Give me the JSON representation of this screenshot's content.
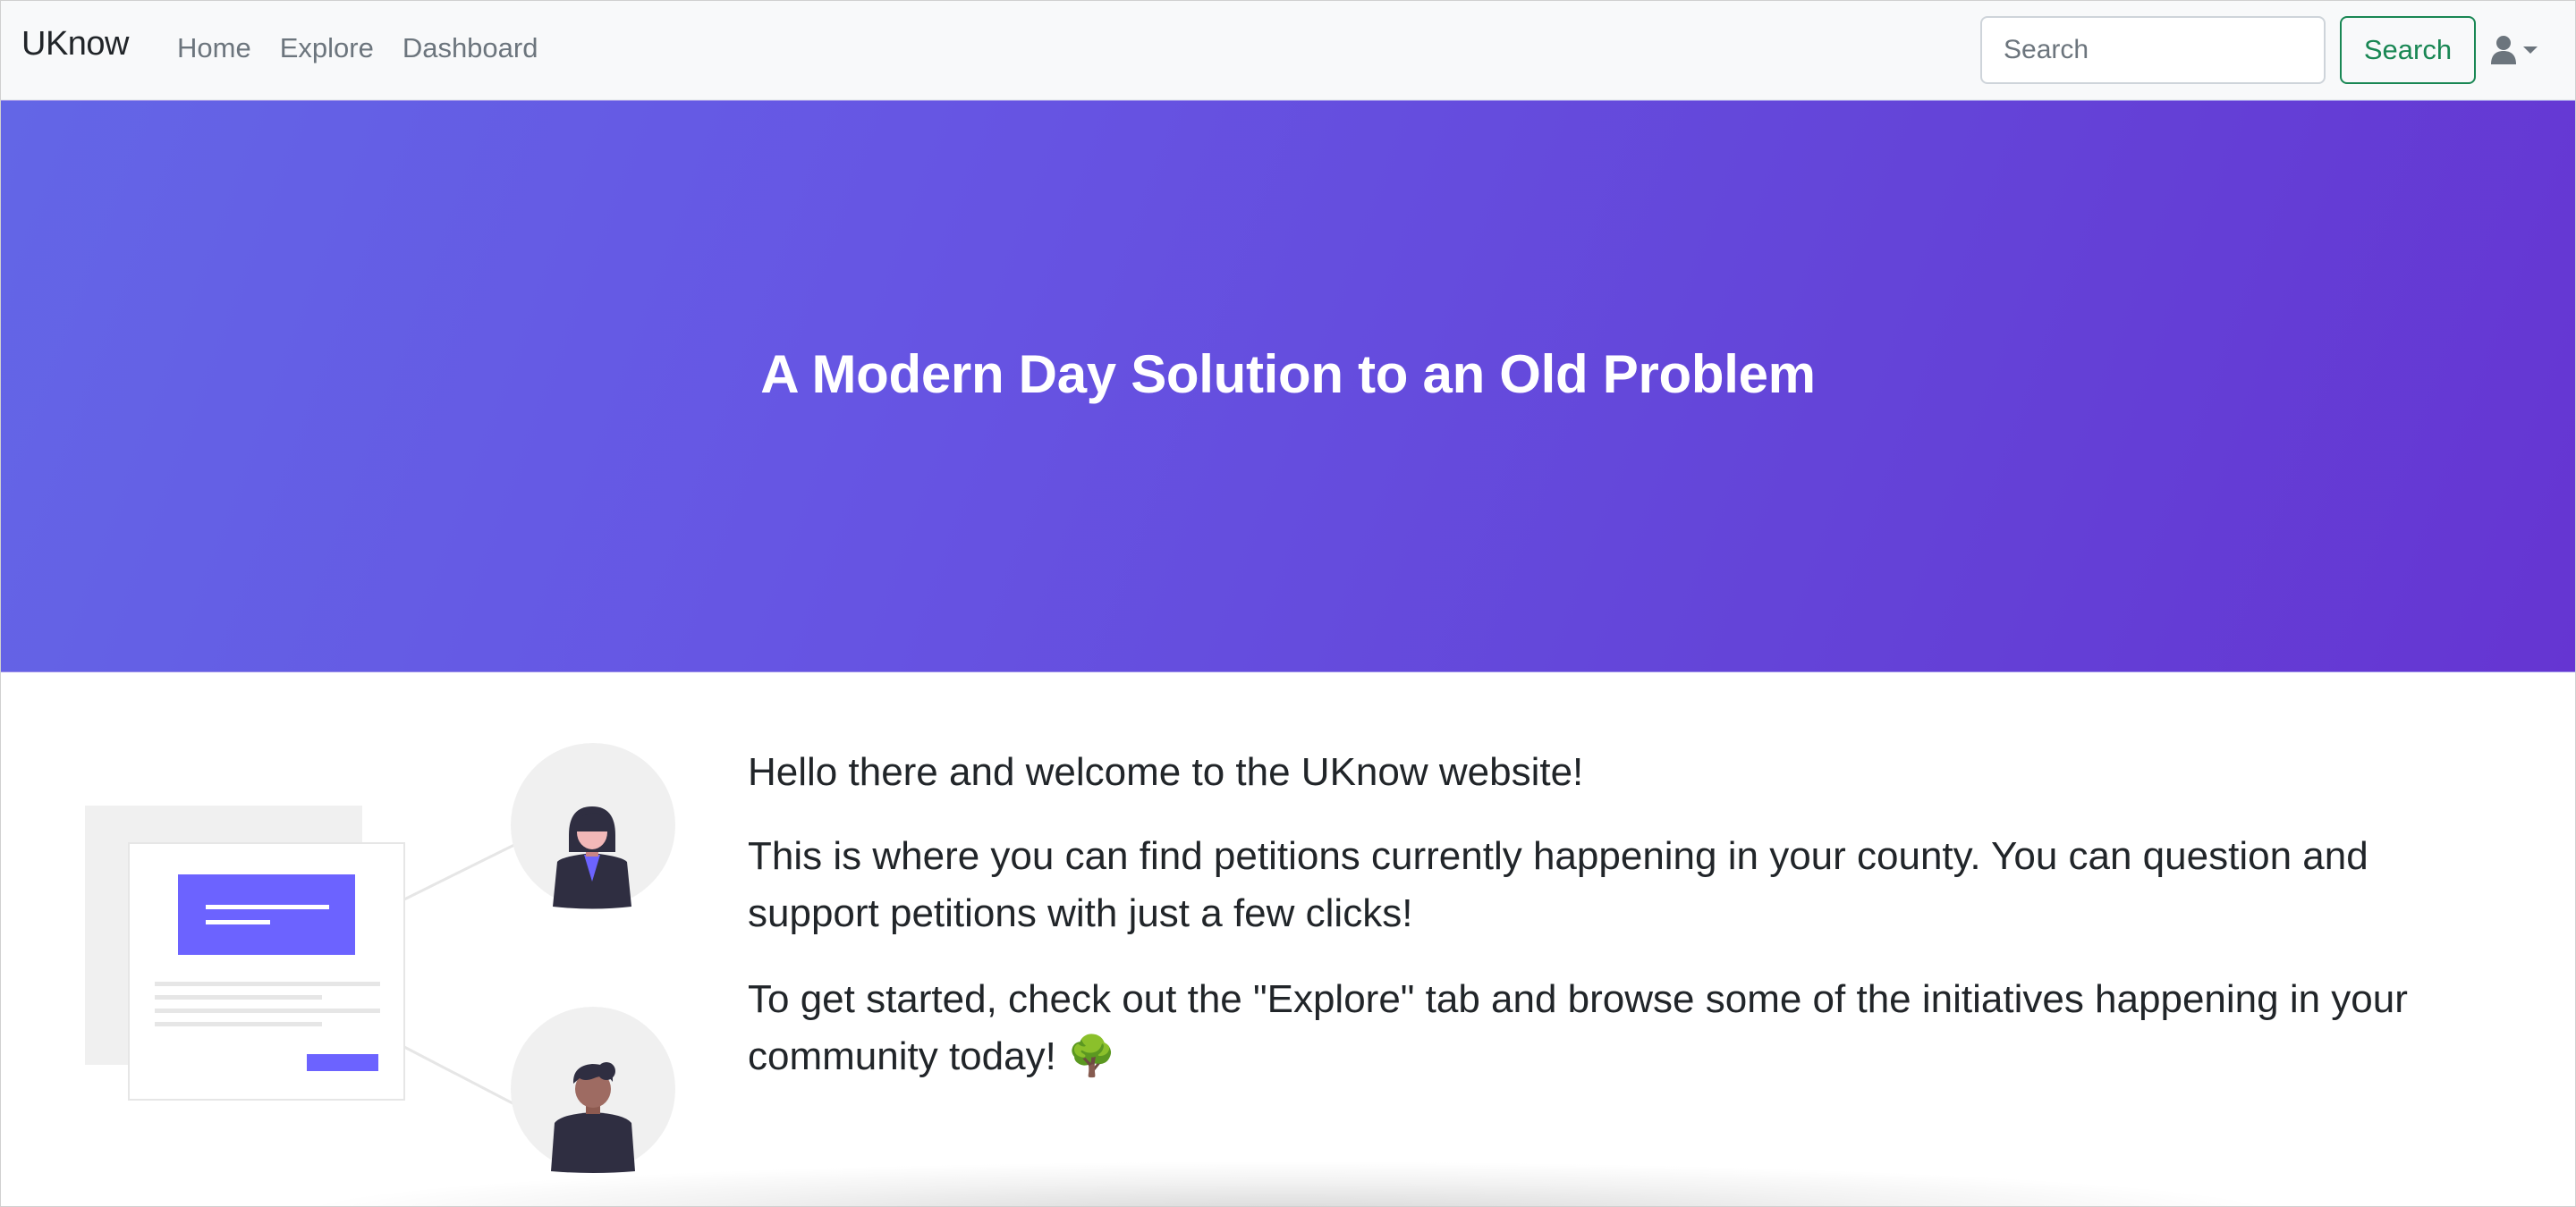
{
  "navbar": {
    "brand": "UKnow",
    "links": [
      {
        "label": "Home"
      },
      {
        "label": "Explore"
      },
      {
        "label": "Dashboard"
      }
    ],
    "search": {
      "placeholder": "Search",
      "value": "",
      "button_label": "Search"
    },
    "user_menu_icon": "user-icon",
    "user_menu_caret": "caret-down-icon"
  },
  "hero": {
    "title": "A Modern Day Solution to an Old Problem",
    "gradient_colors": [
      "#6366e6",
      "#6535d2"
    ]
  },
  "welcome": {
    "paragraphs": [
      "Hello there and welcome to the UKnow website!",
      "This is where you can find petitions currently happening in your county. You can question and support petitions with just a few clicks!",
      "To get started, check out the \"Explore\" tab and browse some of the initiatives happening in your community today! 🌳"
    ]
  },
  "colors": {
    "accent": "#6c63ff",
    "success": "#198754",
    "navbar_bg": "#f8f9fa"
  }
}
